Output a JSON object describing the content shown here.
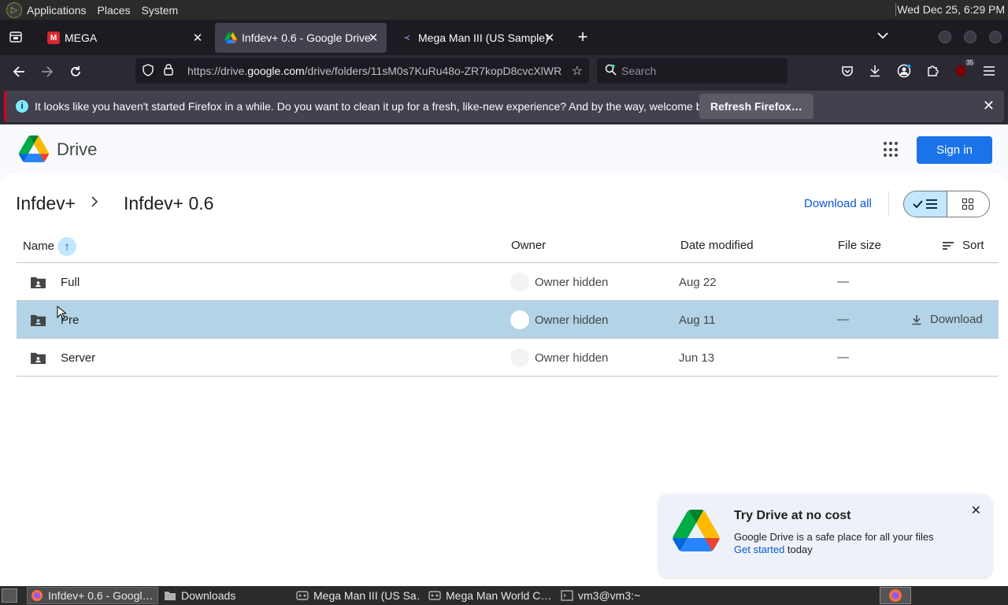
{
  "os_panel": {
    "menus": [
      "Applications",
      "Places",
      "System"
    ],
    "clock": "Wed Dec 25,  6:29 PM"
  },
  "browser": {
    "tabs": [
      {
        "title": "MEGA",
        "active": false
      },
      {
        "title": "Infdev+ 0.6 - Google Drive",
        "active": true
      },
      {
        "title": "Mega Man III (US Sample) - I",
        "active": false
      }
    ],
    "url_prefix": "https://drive.",
    "url_domain": "google.com",
    "url_rest": "/drive/folders/11sM0s7KuRu48o-ZR7kopD8cvcXlWR",
    "search_placeholder": "Search",
    "extension_badge": "35"
  },
  "notification": {
    "message": "It looks like you haven't started Firefox in a while. Do you want to clean it up for a fresh, like-new experience? And by the way, welcome back!",
    "button": "Refresh Firefox…"
  },
  "drive": {
    "app_name": "Drive",
    "sign_in": "Sign in",
    "breadcrumb": [
      "Infdev+",
      "Infdev+ 0.6"
    ],
    "download_all": "Download all",
    "columns": {
      "name": "Name",
      "owner": "Owner",
      "date_modified": "Date modified",
      "file_size": "File size",
      "sort": "Sort"
    },
    "rows": [
      {
        "name": "Full",
        "owner": "Owner hidden",
        "date": "Aug 22",
        "size": "—"
      },
      {
        "name": "Pre",
        "owner": "Owner hidden",
        "date": "Aug 11",
        "size": "—",
        "action": "Download"
      },
      {
        "name": "Server",
        "owner": "Owner hidden",
        "date": "Jun 13",
        "size": "—"
      }
    ],
    "promo": {
      "title": "Try Drive at no cost",
      "line1": "Google Drive is a safe place for all your files",
      "link": "Get started",
      "line2_rest": " today"
    }
  },
  "taskbar": {
    "tasks": [
      {
        "label": "Infdev+ 0.6 - Googl…",
        "active": true
      },
      {
        "label": "Downloads",
        "active": false
      },
      {
        "label": "Mega Man III (US Sa…",
        "active": false
      },
      {
        "label": "Mega Man World C…",
        "active": false
      },
      {
        "label": "vm3@vm3:~",
        "active": false
      }
    ]
  },
  "colors": {
    "accent": "#1a73e8",
    "selected_row": "#b3d3e6",
    "link": "#0b57d0"
  }
}
